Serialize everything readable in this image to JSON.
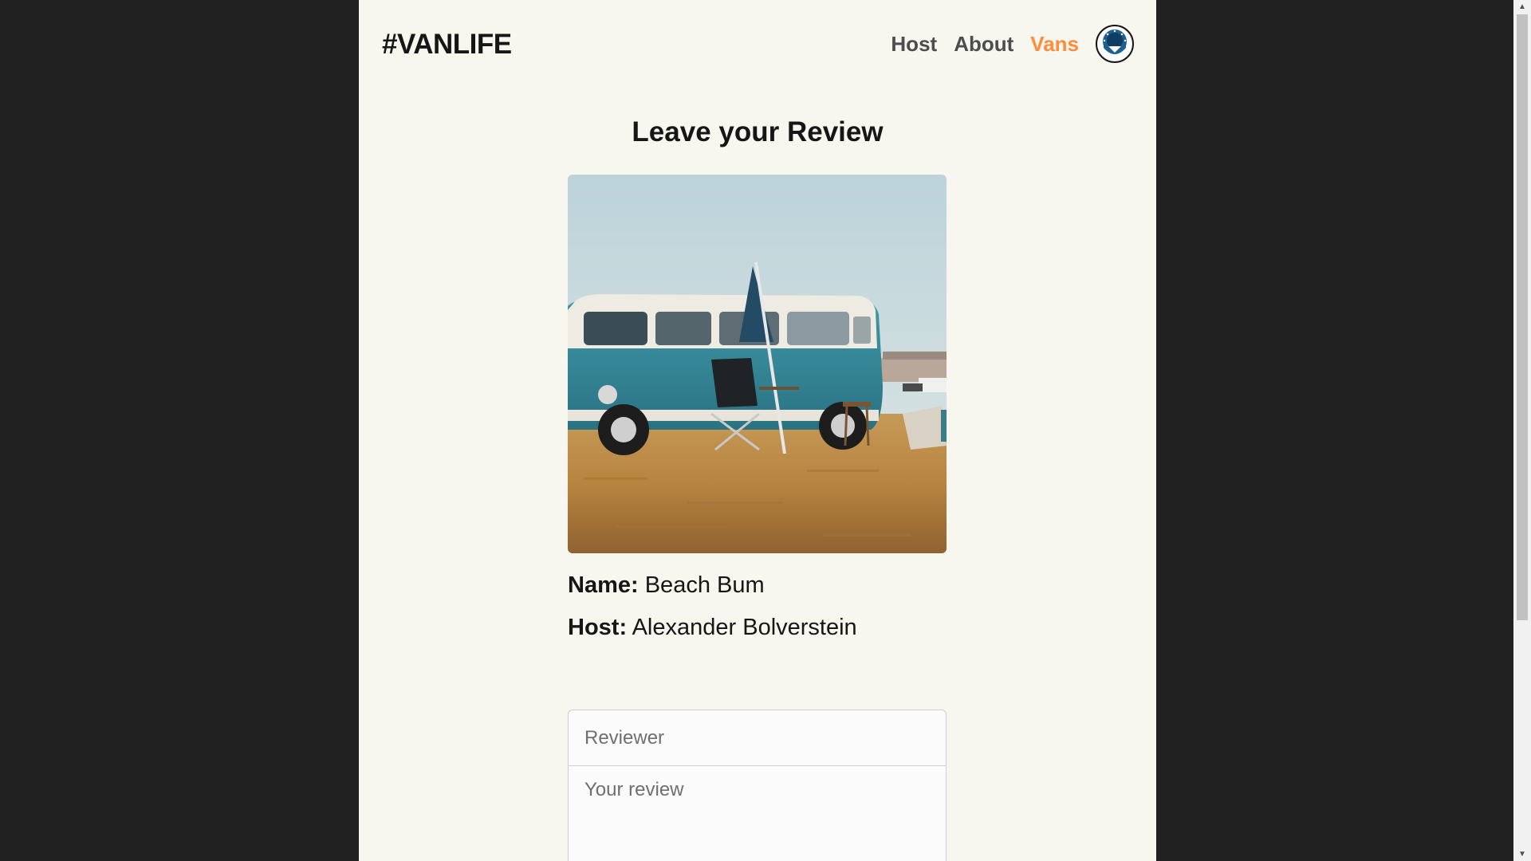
{
  "header": {
    "logo": "#VANLIFE",
    "nav": [
      {
        "label": "Host",
        "active": false
      },
      {
        "label": "About",
        "active": false
      },
      {
        "label": "Vans",
        "active": true
      }
    ],
    "avatar_icon": "avatar-badge-icon",
    "accent_color": "#ff8c38"
  },
  "main": {
    "title": "Leave your Review",
    "image_alt": "Teal camper van parked on a grassy field with a folding chair and umbrella",
    "van": {
      "name_label": "Name:",
      "name_value": "Beach Bum",
      "host_label": "Host:",
      "host_value": "Alexander Bolverstein"
    },
    "form": {
      "reviewer_placeholder": "Reviewer",
      "review_placeholder": "Your review"
    }
  },
  "colors": {
    "page_background": "#f7f6ef",
    "outer_background": "#212121",
    "text": "#161616",
    "nav_text": "#4d4d4d"
  }
}
